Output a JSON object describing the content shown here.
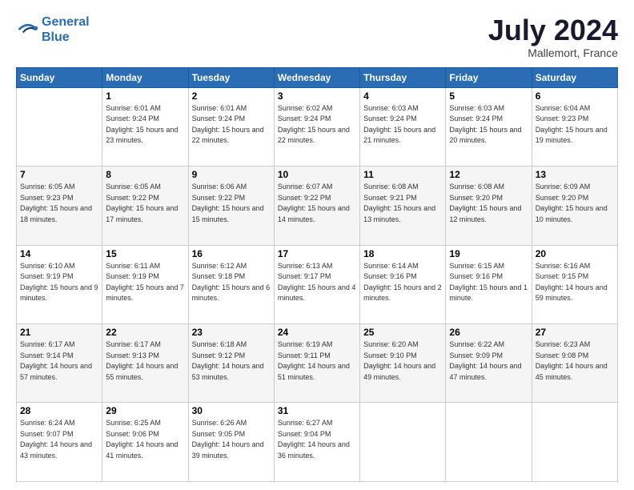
{
  "logo": {
    "line1": "General",
    "line2": "Blue"
  },
  "title": "July 2024",
  "location": "Mallemort, France",
  "days_of_week": [
    "Sunday",
    "Monday",
    "Tuesday",
    "Wednesday",
    "Thursday",
    "Friday",
    "Saturday"
  ],
  "weeks": [
    {
      "days": [
        {
          "num": "",
          "sunrise": "",
          "sunset": "",
          "daylight": ""
        },
        {
          "num": "1",
          "sunrise": "Sunrise: 6:01 AM",
          "sunset": "Sunset: 9:24 PM",
          "daylight": "Daylight: 15 hours and 23 minutes."
        },
        {
          "num": "2",
          "sunrise": "Sunrise: 6:01 AM",
          "sunset": "Sunset: 9:24 PM",
          "daylight": "Daylight: 15 hours and 22 minutes."
        },
        {
          "num": "3",
          "sunrise": "Sunrise: 6:02 AM",
          "sunset": "Sunset: 9:24 PM",
          "daylight": "Daylight: 15 hours and 22 minutes."
        },
        {
          "num": "4",
          "sunrise": "Sunrise: 6:03 AM",
          "sunset": "Sunset: 9:24 PM",
          "daylight": "Daylight: 15 hours and 21 minutes."
        },
        {
          "num": "5",
          "sunrise": "Sunrise: 6:03 AM",
          "sunset": "Sunset: 9:24 PM",
          "daylight": "Daylight: 15 hours and 20 minutes."
        },
        {
          "num": "6",
          "sunrise": "Sunrise: 6:04 AM",
          "sunset": "Sunset: 9:23 PM",
          "daylight": "Daylight: 15 hours and 19 minutes."
        }
      ]
    },
    {
      "days": [
        {
          "num": "7",
          "sunrise": "Sunrise: 6:05 AM",
          "sunset": "Sunset: 9:23 PM",
          "daylight": "Daylight: 15 hours and 18 minutes."
        },
        {
          "num": "8",
          "sunrise": "Sunrise: 6:05 AM",
          "sunset": "Sunset: 9:22 PM",
          "daylight": "Daylight: 15 hours and 17 minutes."
        },
        {
          "num": "9",
          "sunrise": "Sunrise: 6:06 AM",
          "sunset": "Sunset: 9:22 PM",
          "daylight": "Daylight: 15 hours and 15 minutes."
        },
        {
          "num": "10",
          "sunrise": "Sunrise: 6:07 AM",
          "sunset": "Sunset: 9:22 PM",
          "daylight": "Daylight: 15 hours and 14 minutes."
        },
        {
          "num": "11",
          "sunrise": "Sunrise: 6:08 AM",
          "sunset": "Sunset: 9:21 PM",
          "daylight": "Daylight: 15 hours and 13 minutes."
        },
        {
          "num": "12",
          "sunrise": "Sunrise: 6:08 AM",
          "sunset": "Sunset: 9:20 PM",
          "daylight": "Daylight: 15 hours and 12 minutes."
        },
        {
          "num": "13",
          "sunrise": "Sunrise: 6:09 AM",
          "sunset": "Sunset: 9:20 PM",
          "daylight": "Daylight: 15 hours and 10 minutes."
        }
      ]
    },
    {
      "days": [
        {
          "num": "14",
          "sunrise": "Sunrise: 6:10 AM",
          "sunset": "Sunset: 9:19 PM",
          "daylight": "Daylight: 15 hours and 9 minutes."
        },
        {
          "num": "15",
          "sunrise": "Sunrise: 6:11 AM",
          "sunset": "Sunset: 9:19 PM",
          "daylight": "Daylight: 15 hours and 7 minutes."
        },
        {
          "num": "16",
          "sunrise": "Sunrise: 6:12 AM",
          "sunset": "Sunset: 9:18 PM",
          "daylight": "Daylight: 15 hours and 6 minutes."
        },
        {
          "num": "17",
          "sunrise": "Sunrise: 6:13 AM",
          "sunset": "Sunset: 9:17 PM",
          "daylight": "Daylight: 15 hours and 4 minutes."
        },
        {
          "num": "18",
          "sunrise": "Sunrise: 6:14 AM",
          "sunset": "Sunset: 9:16 PM",
          "daylight": "Daylight: 15 hours and 2 minutes."
        },
        {
          "num": "19",
          "sunrise": "Sunrise: 6:15 AM",
          "sunset": "Sunset: 9:16 PM",
          "daylight": "Daylight: 15 hours and 1 minute."
        },
        {
          "num": "20",
          "sunrise": "Sunrise: 6:16 AM",
          "sunset": "Sunset: 9:15 PM",
          "daylight": "Daylight: 14 hours and 59 minutes."
        }
      ]
    },
    {
      "days": [
        {
          "num": "21",
          "sunrise": "Sunrise: 6:17 AM",
          "sunset": "Sunset: 9:14 PM",
          "daylight": "Daylight: 14 hours and 57 minutes."
        },
        {
          "num": "22",
          "sunrise": "Sunrise: 6:17 AM",
          "sunset": "Sunset: 9:13 PM",
          "daylight": "Daylight: 14 hours and 55 minutes."
        },
        {
          "num": "23",
          "sunrise": "Sunrise: 6:18 AM",
          "sunset": "Sunset: 9:12 PM",
          "daylight": "Daylight: 14 hours and 53 minutes."
        },
        {
          "num": "24",
          "sunrise": "Sunrise: 6:19 AM",
          "sunset": "Sunset: 9:11 PM",
          "daylight": "Daylight: 14 hours and 51 minutes."
        },
        {
          "num": "25",
          "sunrise": "Sunrise: 6:20 AM",
          "sunset": "Sunset: 9:10 PM",
          "daylight": "Daylight: 14 hours and 49 minutes."
        },
        {
          "num": "26",
          "sunrise": "Sunrise: 6:22 AM",
          "sunset": "Sunset: 9:09 PM",
          "daylight": "Daylight: 14 hours and 47 minutes."
        },
        {
          "num": "27",
          "sunrise": "Sunrise: 6:23 AM",
          "sunset": "Sunset: 9:08 PM",
          "daylight": "Daylight: 14 hours and 45 minutes."
        }
      ]
    },
    {
      "days": [
        {
          "num": "28",
          "sunrise": "Sunrise: 6:24 AM",
          "sunset": "Sunset: 9:07 PM",
          "daylight": "Daylight: 14 hours and 43 minutes."
        },
        {
          "num": "29",
          "sunrise": "Sunrise: 6:25 AM",
          "sunset": "Sunset: 9:06 PM",
          "daylight": "Daylight: 14 hours and 41 minutes."
        },
        {
          "num": "30",
          "sunrise": "Sunrise: 6:26 AM",
          "sunset": "Sunset: 9:05 PM",
          "daylight": "Daylight: 14 hours and 39 minutes."
        },
        {
          "num": "31",
          "sunrise": "Sunrise: 6:27 AM",
          "sunset": "Sunset: 9:04 PM",
          "daylight": "Daylight: 14 hours and 36 minutes."
        },
        {
          "num": "",
          "sunrise": "",
          "sunset": "",
          "daylight": ""
        },
        {
          "num": "",
          "sunrise": "",
          "sunset": "",
          "daylight": ""
        },
        {
          "num": "",
          "sunrise": "",
          "sunset": "",
          "daylight": ""
        }
      ]
    }
  ]
}
